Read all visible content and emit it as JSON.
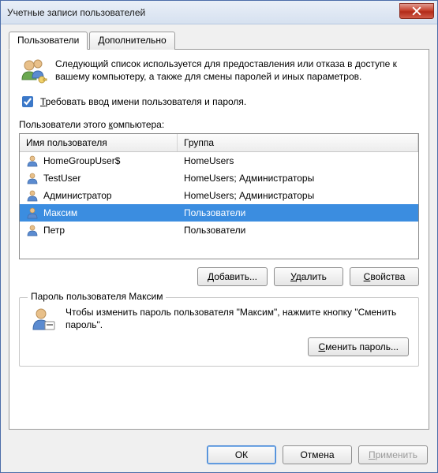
{
  "window": {
    "title": "Учетные записи пользователей"
  },
  "tabs": {
    "users": "Пользователи",
    "advanced": "Дополнительно"
  },
  "intro": {
    "text": "Следующий список используется для предоставления или отказа в доступе к вашему компьютеру, а также для смены паролей и иных параметров."
  },
  "require_credentials": {
    "mnemonic": "Т",
    "label_rest": "ребовать ввод имени пользователя и пароля.",
    "checked": true
  },
  "list": {
    "label_prefix": "Пользователи этого ",
    "label_mnemonic": "к",
    "label_rest": "омпьютера:",
    "columns": {
      "name": "Имя пользователя",
      "group": "Группа"
    },
    "rows": [
      {
        "name": "HomeGroupUser$",
        "group": "HomeUsers",
        "selected": false
      },
      {
        "name": "TestUser",
        "group": "HomeUsers; Администраторы",
        "selected": false
      },
      {
        "name": "Администратор",
        "group": "HomeUsers; Администраторы",
        "selected": false
      },
      {
        "name": "Максим",
        "group": "Пользователи",
        "selected": true
      },
      {
        "name": "Петр",
        "group": "Пользователи",
        "selected": false
      }
    ]
  },
  "buttons": {
    "add_mnemonic": "Д",
    "add_rest": "обавить...",
    "remove_mnemonic": "У",
    "remove_rest": "далить",
    "props_mnemonic": "С",
    "props_rest": "войства"
  },
  "password_group": {
    "legend": "Пароль пользователя Максим",
    "text": "Чтобы изменить пароль пользователя \"Максим\", нажмите кнопку \"Сменить пароль\".",
    "change_mnemonic": "С",
    "change_rest": "менить пароль..."
  },
  "dialog_buttons": {
    "ok": "ОК",
    "cancel": "Отмена",
    "apply_mnemonic": "П",
    "apply_rest": "рименить"
  }
}
